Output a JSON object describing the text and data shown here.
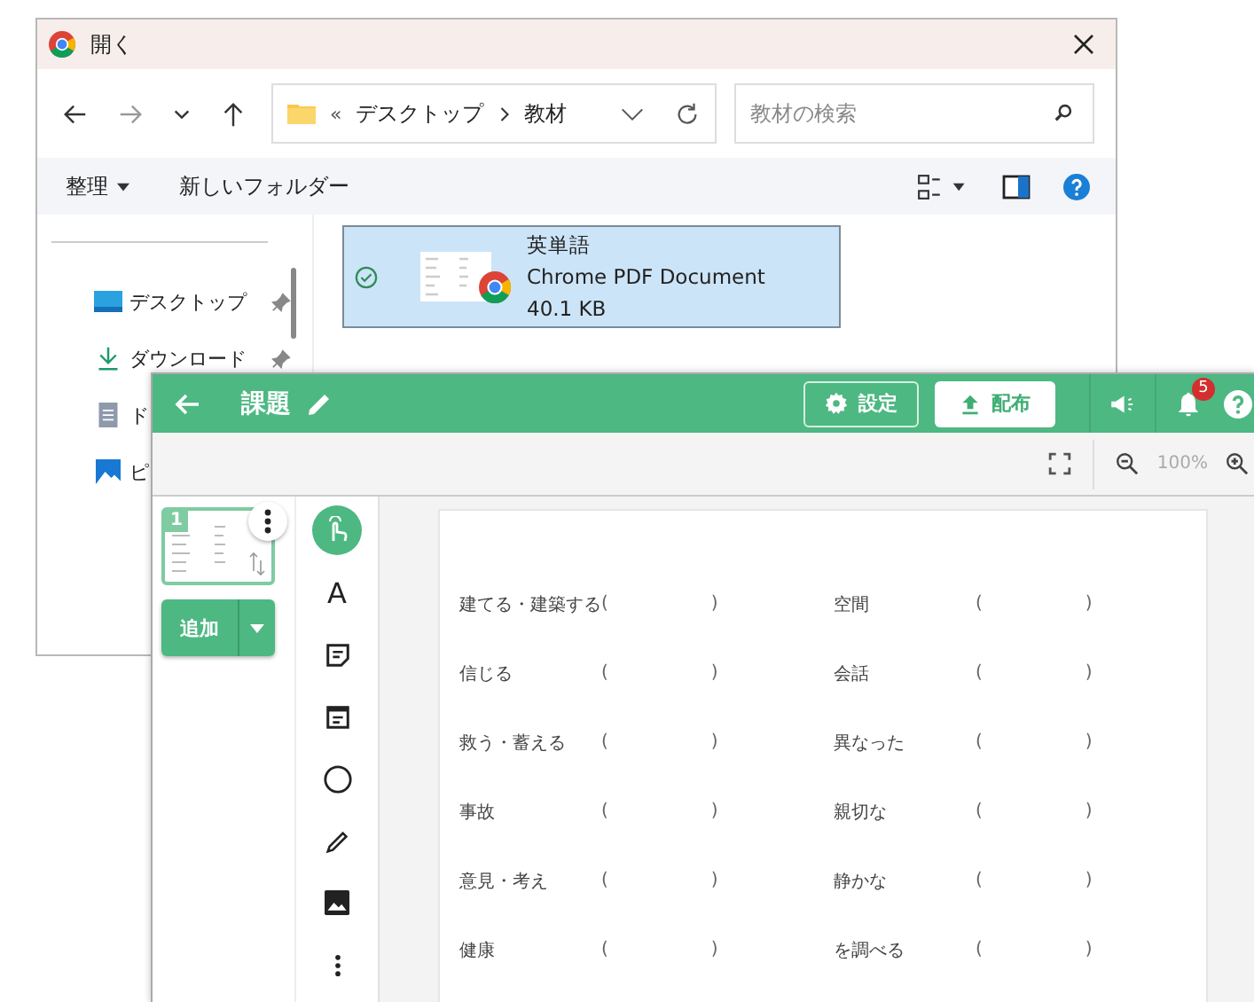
{
  "explorer": {
    "title": "開く",
    "nav": {
      "prefix": "«",
      "path": [
        "デスクトップ",
        "教材"
      ]
    },
    "search": {
      "placeholder": "教材の検索"
    },
    "toolbar": [
      "整理",
      "新しいフォルダー"
    ],
    "sidebar": [
      {
        "label": "デスクトップ",
        "kind": "desktop",
        "pinned": true
      },
      {
        "label": "ダウンロード",
        "kind": "download",
        "pinned": true
      },
      {
        "label": "ド",
        "kind": "document"
      },
      {
        "label": "ピ",
        "kind": "pictures"
      }
    ],
    "file": {
      "name": "英単語",
      "type": "Chrome PDF Document",
      "size": "40.1 KB",
      "selected": true
    }
  },
  "app": {
    "title": "課題",
    "buttons": [
      {
        "label": "設定",
        "kind": "outline"
      },
      {
        "label": "配布",
        "kind": "filled"
      }
    ],
    "notifications": "5",
    "zoom": "100%",
    "page_number": "1",
    "add_button": "追加",
    "tools": [
      {
        "kind": "pointer",
        "selected": true
      },
      {
        "kind": "text",
        "label": "A",
        "selected": false
      },
      {
        "kind": "note",
        "selected": false
      },
      {
        "kind": "textbox",
        "selected": false
      },
      {
        "kind": "circle",
        "selected": false
      },
      {
        "kind": "pen",
        "selected": false
      },
      {
        "kind": "image",
        "selected": false
      },
      {
        "kind": "more",
        "selected": false
      }
    ],
    "worksheet": [
      {
        "word": "建てる・建築する",
        "open": "(",
        "close": ")"
      },
      {
        "word": "空間",
        "open": "(",
        "close": ")"
      },
      {
        "word": "信じる",
        "open": "(",
        "close": ")"
      },
      {
        "word": "会話",
        "open": "(",
        "close": ")"
      },
      {
        "word": "救う・蓄える",
        "open": "(",
        "close": ")"
      },
      {
        "word": "異なった",
        "open": "(",
        "close": ")"
      },
      {
        "word": "事故",
        "open": "(",
        "close": ")"
      },
      {
        "word": "親切な",
        "open": "(",
        "close": ")"
      },
      {
        "word": "意見・考え",
        "open": "(",
        "close": ")"
      },
      {
        "word": "静かな",
        "open": "(",
        "close": ")"
      },
      {
        "word": "健康",
        "open": "(",
        "close": ")"
      },
      {
        "word": "を調べる",
        "open": "(",
        "close": ")"
      }
    ]
  }
}
